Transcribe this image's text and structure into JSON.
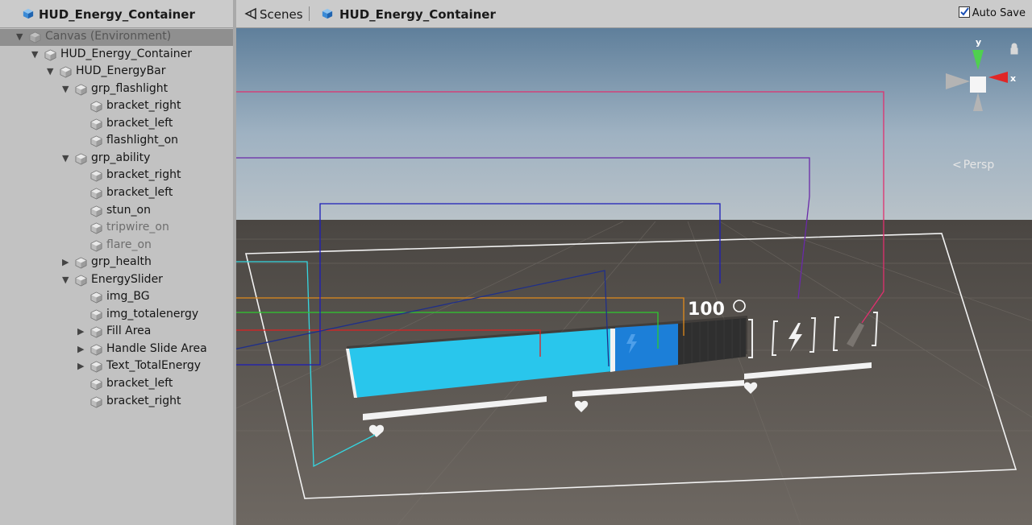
{
  "hierarchy": {
    "title": "HUD_Energy_Container",
    "items": [
      {
        "label": "Canvas (Environment)",
        "depth": 0,
        "expanded": "down",
        "selected": true,
        "dim": false
      },
      {
        "label": "HUD_Energy_Container",
        "depth": 1,
        "expanded": "down",
        "selected": false,
        "dim": false
      },
      {
        "label": "HUD_EnergyBar",
        "depth": 2,
        "expanded": "down",
        "selected": false,
        "dim": false
      },
      {
        "label": "grp_flashlight",
        "depth": 3,
        "expanded": "down",
        "selected": false,
        "dim": false
      },
      {
        "label": "bracket_right",
        "depth": 4,
        "expanded": "none",
        "selected": false,
        "dim": false
      },
      {
        "label": "bracket_left",
        "depth": 4,
        "expanded": "none",
        "selected": false,
        "dim": false
      },
      {
        "label": "flashlight_on",
        "depth": 4,
        "expanded": "none",
        "selected": false,
        "dim": false
      },
      {
        "label": "grp_ability",
        "depth": 3,
        "expanded": "down",
        "selected": false,
        "dim": false
      },
      {
        "label": "bracket_right",
        "depth": 4,
        "expanded": "none",
        "selected": false,
        "dim": false
      },
      {
        "label": "bracket_left",
        "depth": 4,
        "expanded": "none",
        "selected": false,
        "dim": false
      },
      {
        "label": "stun_on",
        "depth": 4,
        "expanded": "none",
        "selected": false,
        "dim": false
      },
      {
        "label": "tripwire_on",
        "depth": 4,
        "expanded": "none",
        "selected": false,
        "dim": true
      },
      {
        "label": "flare_on",
        "depth": 4,
        "expanded": "none",
        "selected": false,
        "dim": true
      },
      {
        "label": "grp_health",
        "depth": 3,
        "expanded": "right",
        "selected": false,
        "dim": false
      },
      {
        "label": "EnergySlider",
        "depth": 3,
        "expanded": "down",
        "selected": false,
        "dim": false
      },
      {
        "label": "img_BG",
        "depth": 4,
        "expanded": "none",
        "selected": false,
        "dim": false
      },
      {
        "label": "img_totalenergy",
        "depth": 4,
        "expanded": "none",
        "selected": false,
        "dim": false
      },
      {
        "label": "Fill Area",
        "depth": 4,
        "expanded": "right",
        "selected": false,
        "dim": false
      },
      {
        "label": "Handle Slide Area",
        "depth": 4,
        "expanded": "right",
        "selected": false,
        "dim": false
      },
      {
        "label": "Text_TotalEnergy",
        "depth": 4,
        "expanded": "right",
        "selected": false,
        "dim": false
      },
      {
        "label": "bracket_left",
        "depth": 4,
        "expanded": "none",
        "selected": false,
        "dim": false
      },
      {
        "label": "bracket_right",
        "depth": 4,
        "expanded": "none",
        "selected": false,
        "dim": false
      }
    ]
  },
  "scene": {
    "tab_label": "Scenes",
    "breadcrumb": "HUD_Energy_Container",
    "auto_save_label": "Auto Save",
    "auto_save_checked": true,
    "projection_label": "Persp",
    "gizmo": {
      "y_label": "y",
      "x_label": "x"
    },
    "energy_value": "100",
    "energy_fill": 0.68,
    "total_energy": 0.82,
    "health_icon": "heart-icon",
    "ability_icon": "lightning-icon",
    "flashlight_icon": "flashlight-icon"
  },
  "annotation_colors": {
    "grp_flashlight": "#e0306e",
    "grp_ability": "#6a2aa8",
    "grp_health": "#35d6e0",
    "img_BG": "#e08a1c",
    "img_totalenergy": "#2ec92e",
    "Fill Area": "#e02020",
    "Handle Slide Area": "#1f2f8a",
    "Text_TotalEnergy": "#1d1db8"
  },
  "colors": {
    "energy_cyan": "#29c6ec",
    "energy_blue": "#1c7fd8",
    "energy_dark": "#2f2f2f",
    "hierarchy_bg": "#c2c2c2",
    "selection": "#8f8f8f"
  }
}
